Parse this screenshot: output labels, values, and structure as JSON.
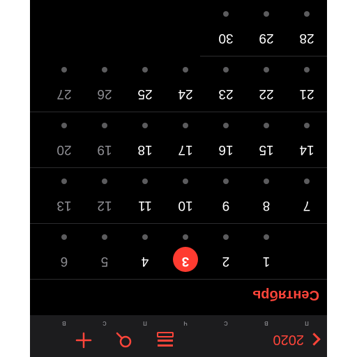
{
  "toolbar": {
    "year_label": "2020",
    "year_chevron_icon": "chevron-left-icon",
    "list_icon": "list-icon",
    "search_icon": "search-icon",
    "add_icon": "plus-icon"
  },
  "weekdays": [
    "п",
    "в",
    "с",
    "ч",
    "п",
    "с",
    "в"
  ],
  "month": {
    "title": "Сентябрь"
  },
  "weeks": [
    [
      "",
      "1",
      "2",
      "3",
      "4",
      "5",
      "6"
    ],
    [
      "7",
      "8",
      "9",
      "10",
      "11",
      "12",
      "13"
    ],
    [
      "14",
      "15",
      "16",
      "17",
      "18",
      "19",
      "20"
    ],
    [
      "21",
      "22",
      "23",
      "24",
      "25",
      "26",
      "27"
    ],
    [
      "28",
      "29",
      "30",
      "",
      "",
      "",
      ""
    ]
  ],
  "today": "3",
  "colors": {
    "accent": "#ff3b30",
    "background": "#000000",
    "toolbar": "#1c1c1e"
  }
}
